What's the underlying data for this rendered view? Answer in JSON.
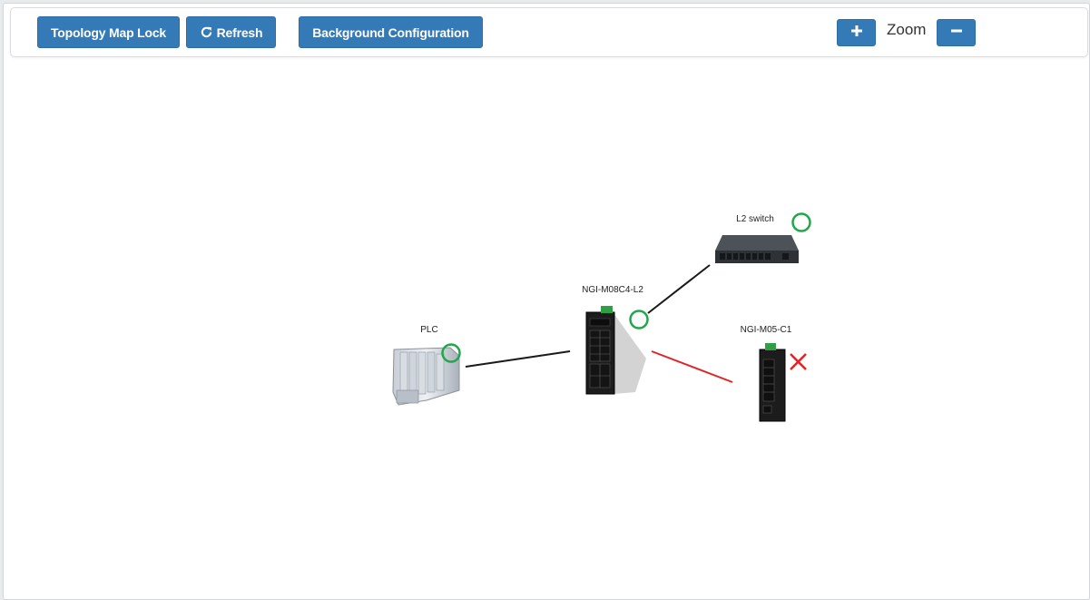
{
  "toolbar": {
    "lock_label": "Topology Map Lock",
    "refresh_label": "Refresh",
    "background_label": "Background Configuration",
    "zoom_label": "Zoom",
    "zoom_in_icon": "plus-icon",
    "zoom_out_icon": "minus-icon",
    "refresh_icon": "refresh-icon"
  },
  "topology": {
    "nodes": [
      {
        "id": "plc",
        "label": "PLC",
        "status": "up"
      },
      {
        "id": "ngi-m08c4-l2",
        "label": "NGI-M08C4-L2",
        "status": "up"
      },
      {
        "id": "l2-switch",
        "label": "L2 switch",
        "status": "up"
      },
      {
        "id": "ngi-m05-c1",
        "label": "NGI-M05-C1",
        "status": "down"
      }
    ],
    "links": [
      {
        "from": "plc",
        "to": "ngi-m08c4-l2",
        "status": "up"
      },
      {
        "from": "ngi-m08c4-l2",
        "to": "l2-switch",
        "status": "up"
      },
      {
        "from": "ngi-m08c4-l2",
        "to": "ngi-m05-c1",
        "status": "down"
      }
    ],
    "colors": {
      "button": "#337ab7",
      "link_up": "#1a1a1a",
      "link_down": "#e02424",
      "status_up": "#21a84a",
      "status_down": "#e02424"
    }
  }
}
